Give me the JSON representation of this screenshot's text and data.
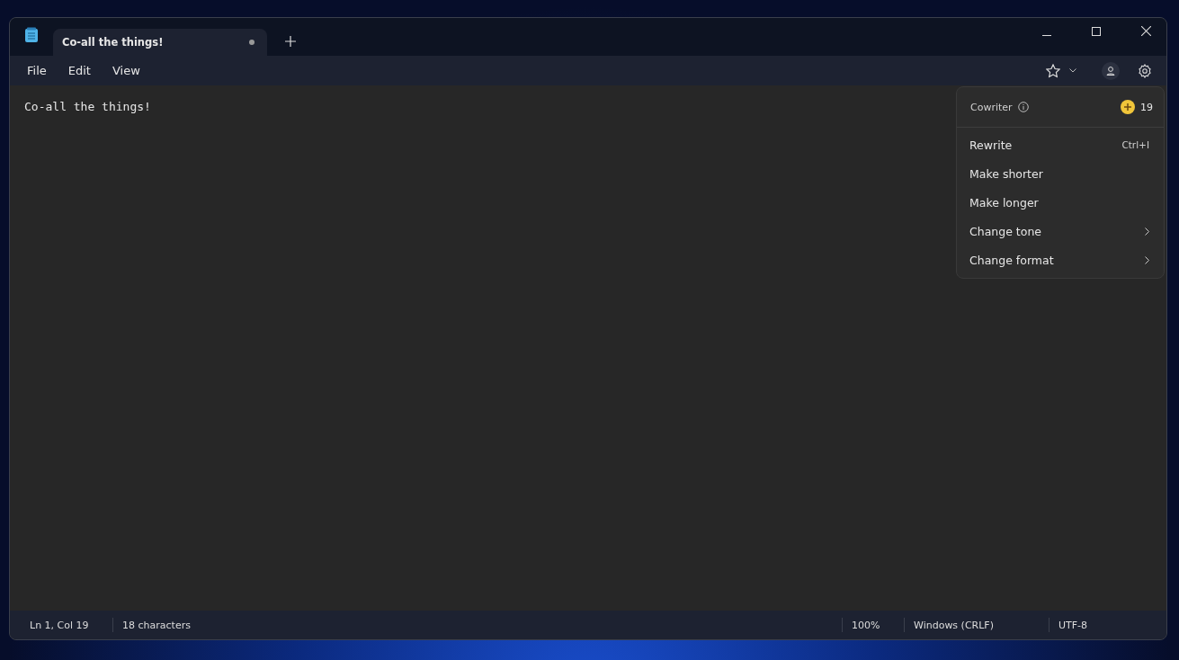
{
  "tabs": [
    {
      "label": "Co-all the things!",
      "selected": true,
      "modified": true
    }
  ],
  "menu_bar": [
    "File",
    "Edit",
    "View"
  ],
  "editor": {
    "text": "Co-all the things!"
  },
  "cowriter": {
    "title": "Cowriter",
    "credits": "19",
    "items": [
      {
        "label": "Rewrite",
        "kind": "shortcut",
        "shortcut": "Ctrl+I"
      },
      {
        "label": "Make shorter",
        "kind": "plain"
      },
      {
        "label": "Make longer",
        "kind": "plain"
      },
      {
        "label": "Change tone",
        "kind": "submenu"
      },
      {
        "label": "Change format",
        "kind": "submenu"
      }
    ]
  },
  "status_bar": {
    "position": "Ln 1, Col 19",
    "characters": "18 characters",
    "zoom": "100%",
    "line_ending": "Windows (CRLF)",
    "encoding": "UTF-8"
  }
}
